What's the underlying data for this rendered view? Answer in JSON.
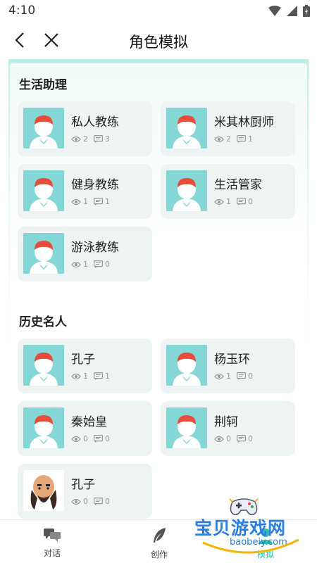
{
  "status_bar": {
    "time": "4:10"
  },
  "header": {
    "title": "角色模拟"
  },
  "sections": [
    {
      "title": "生活助理",
      "cards": [
        {
          "name": "私人教练",
          "views": "2",
          "comments": "3"
        },
        {
          "name": "米其林厨师",
          "views": "2",
          "comments": "1"
        },
        {
          "name": "健身教练",
          "views": "1",
          "comments": "1"
        },
        {
          "name": "生活管家",
          "views": "1",
          "comments": "0"
        },
        {
          "name": "游泳教练",
          "views": "1",
          "comments": "0"
        }
      ]
    },
    {
      "title": "历史名人",
      "cards": [
        {
          "name": "孔子",
          "views": "1",
          "comments": "1"
        },
        {
          "name": "杨玉环",
          "views": "1",
          "comments": "0"
        },
        {
          "name": "秦始皇",
          "views": "0",
          "comments": "0"
        },
        {
          "name": "荆轲",
          "views": "0",
          "comments": "0"
        },
        {
          "name": "孔子",
          "views": "0",
          "comments": "0"
        }
      ]
    }
  ],
  "bottom_nav": [
    {
      "label": "对话",
      "icon": "chat-icon"
    },
    {
      "label": "创作",
      "icon": "feather-icon"
    },
    {
      "label": "模拟",
      "icon": "simulate-icon"
    }
  ],
  "watermark": {
    "text": "宝贝游戏网",
    "url": "baobeiy.com"
  }
}
